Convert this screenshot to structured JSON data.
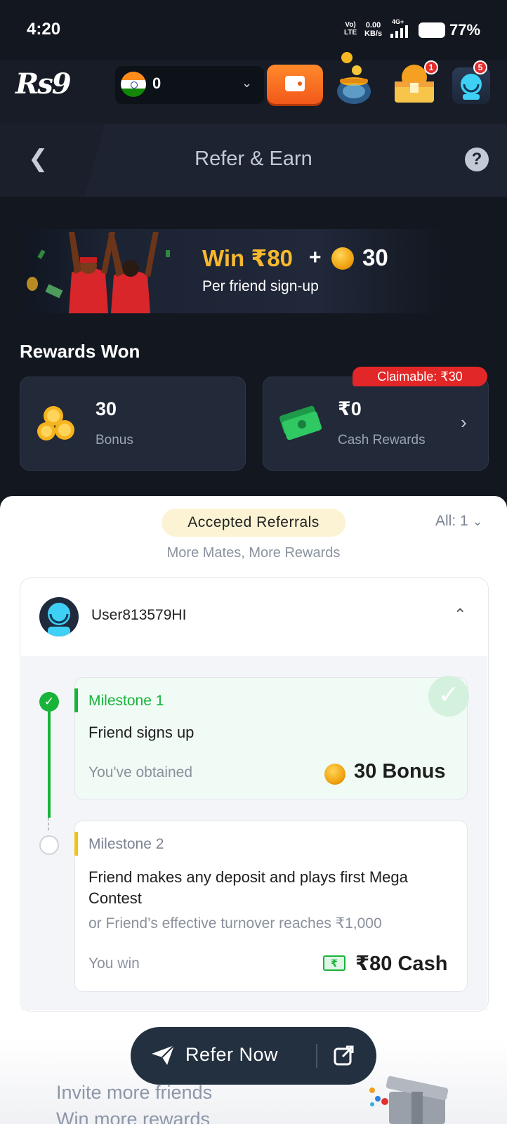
{
  "status_bar": {
    "time": "4:20",
    "network_top": "Vo)",
    "network_bottom": "LTE",
    "speed_value": "0.00",
    "speed_unit": "KB/s",
    "net_type": "4G+",
    "battery": "77%"
  },
  "app_bar": {
    "logo": "Rs9",
    "balance": "0",
    "rewards_badge": "1",
    "support_badge": "5"
  },
  "header": {
    "title": "Refer & Earn",
    "help": "?"
  },
  "banner": {
    "headline": "Win ₹80",
    "plus": "+",
    "coin_amount": "30",
    "subtitle": "Per friend sign-up"
  },
  "rewards": {
    "title": "Rewards Won",
    "bonus_value": "30",
    "bonus_label": "Bonus",
    "cash_value": "₹0",
    "cash_label": "Cash Rewards",
    "claimable": "Claimable: ₹30"
  },
  "referrals": {
    "pill": "Accepted Referrals",
    "filter": "All: 1",
    "subtitle": "More Mates, More Rewards",
    "user": "User813579HI",
    "milestones": [
      {
        "label": "Milestone 1",
        "title": "Friend signs up",
        "reward_label": "You've obtained",
        "reward": "30 Bonus",
        "color": "#19b33a"
      },
      {
        "label": "Milestone 2",
        "title": "Friend makes any deposit and plays first Mega Contest",
        "sub": "or Friend’s effective turnover reaches ₹1,000",
        "reward_label": "You win",
        "reward": "₹80 Cash",
        "color": "#f2c217"
      }
    ]
  },
  "bottom": {
    "refer_button": "Refer Now",
    "invite_line1": "Invite more friends",
    "invite_line2": "Win more rewards"
  }
}
